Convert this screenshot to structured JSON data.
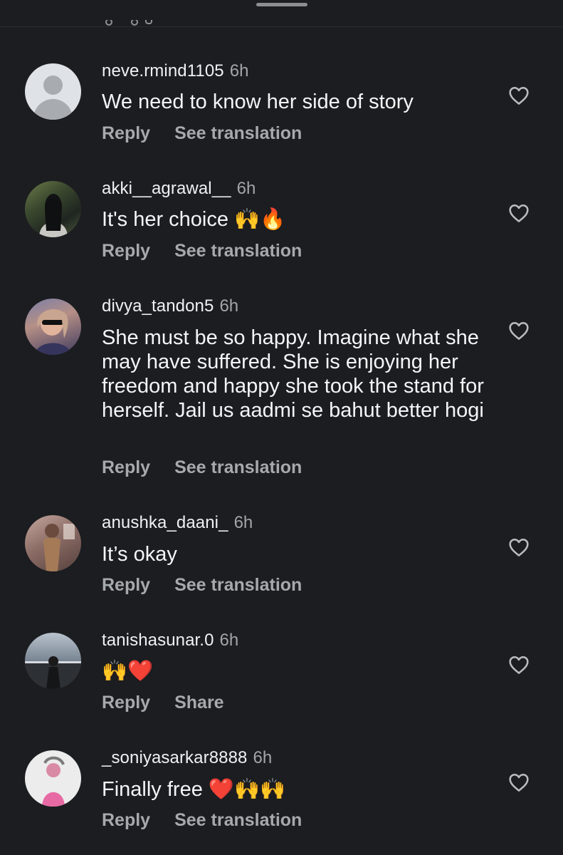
{
  "comments": [
    {
      "username": "neve.rmind1105",
      "time": "6h",
      "text": "We need to know her side of story",
      "reply": "Reply",
      "secondary": "See translation",
      "avatar": "default-avatar"
    },
    {
      "username": "akki__agrawal__",
      "time": "6h",
      "text": "It's her choice 🙌🔥",
      "reply": "Reply",
      "secondary": "See translation",
      "avatar": "photo-avatar"
    },
    {
      "username": "divya_tandon5",
      "time": "6h",
      "text": "She must be so happy. Imagine what she may have suffered. She is enjoying her freedom and happy she took the stand for herself. Jail us aadmi se bahut better hogi",
      "reply": "Reply",
      "secondary": "See translation",
      "avatar": "photo-avatar"
    },
    {
      "username": "anushka_daani_",
      "time": "6h",
      "text": "It’s okay",
      "reply": "Reply",
      "secondary": "See translation",
      "avatar": "photo-avatar"
    },
    {
      "username": "tanishasunar.0",
      "time": "6h",
      "text": "🙌❤️",
      "reply": "Reply",
      "secondary": "Share",
      "avatar": "photo-avatar"
    },
    {
      "username": "_soniyasarkar8888",
      "time": "6h",
      "text": "Finally free ❤️🙌🙌",
      "reply": "Reply",
      "secondary": "See translation",
      "avatar": "photo-avatar"
    }
  ],
  "icons": {
    "like": "heart-outline-icon"
  },
  "colors": {
    "background": "#1b1d20",
    "username": "#f0f1f3",
    "muted": "#a6a9ad"
  }
}
